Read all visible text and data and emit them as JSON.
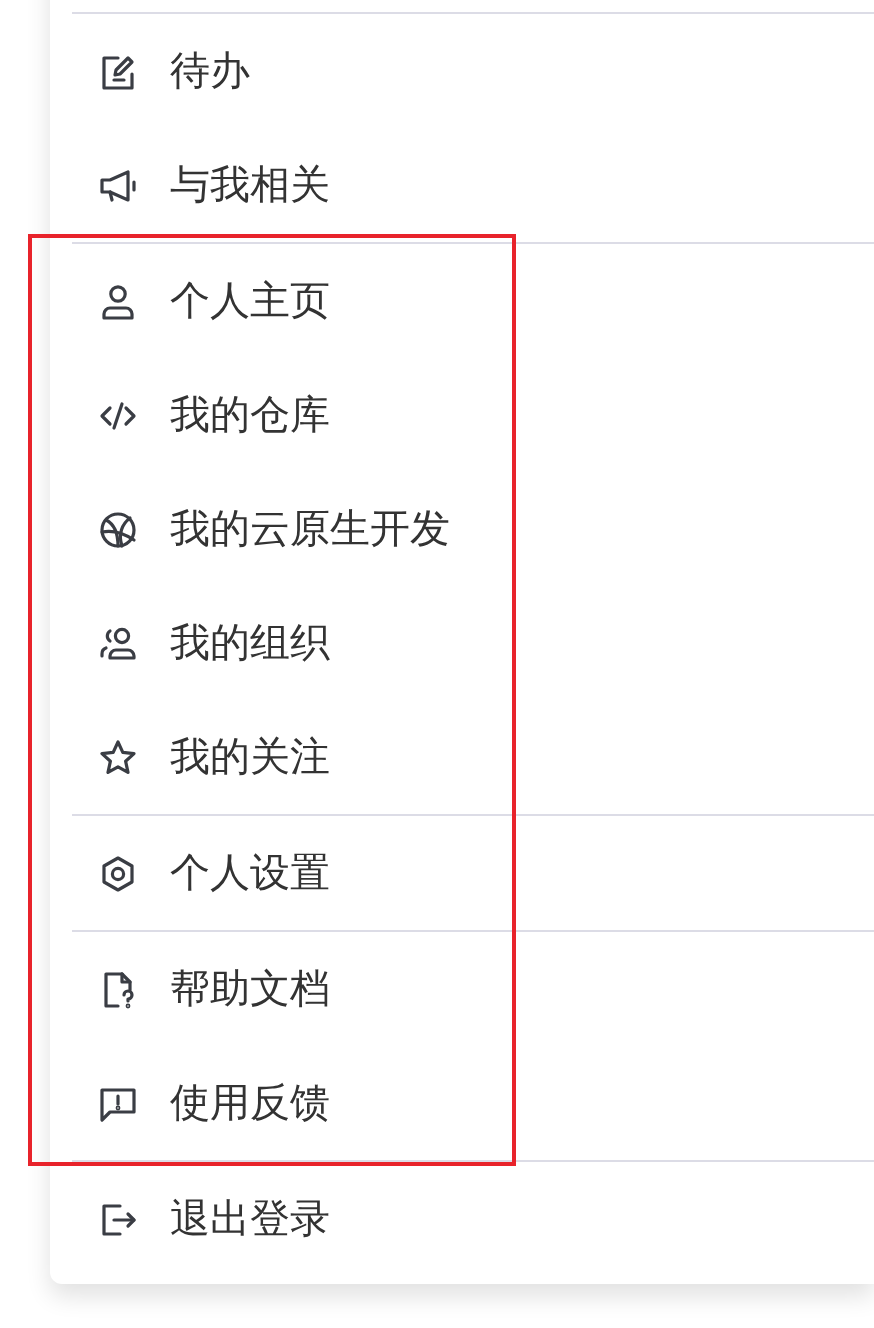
{
  "menu": {
    "groups": [
      {
        "highlighted": false,
        "items": [
          {
            "label": "待办"
          },
          {
            "label": "与我相关"
          }
        ]
      },
      {
        "highlighted": true,
        "items": [
          {
            "label": "个人主页"
          },
          {
            "label": "我的仓库"
          },
          {
            "label": "我的云原生开发"
          },
          {
            "label": "我的组织"
          },
          {
            "label": "我的关注"
          }
        ]
      },
      {
        "highlighted": true,
        "items": [
          {
            "label": "个人设置"
          }
        ]
      },
      {
        "highlighted": true,
        "items": [
          {
            "label": "帮助文档"
          },
          {
            "label": "使用反馈"
          }
        ]
      },
      {
        "highlighted": false,
        "items": [
          {
            "label": "退出登录"
          }
        ]
      }
    ]
  }
}
